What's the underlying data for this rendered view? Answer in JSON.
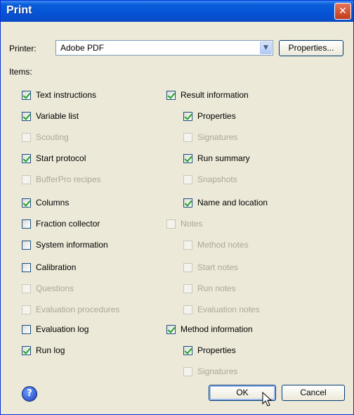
{
  "window": {
    "title": "Print",
    "close_glyph": "✕"
  },
  "printer": {
    "label": "Printer:",
    "selected": "Adobe PDF",
    "properties_button": "Properties..."
  },
  "items_label": "Items:",
  "left_items": [
    {
      "label": "Text instructions",
      "checked": true,
      "enabled": true
    },
    {
      "label": "Variable list",
      "checked": true,
      "enabled": true
    },
    {
      "label": "Scouting",
      "checked": false,
      "enabled": false
    },
    {
      "label": "Start protocol",
      "checked": true,
      "enabled": true
    },
    {
      "label": "BufferPro recipes",
      "checked": false,
      "enabled": false
    },
    {
      "label": "Columns",
      "checked": true,
      "enabled": true
    },
    {
      "label": "Fraction collector",
      "checked": false,
      "enabled": true
    },
    {
      "label": "System information",
      "checked": false,
      "enabled": true
    },
    {
      "label": "Calibration",
      "checked": false,
      "enabled": true
    },
    {
      "label": "Questions",
      "checked": false,
      "enabled": false
    },
    {
      "label": "Evaluation procedures",
      "checked": false,
      "enabled": false
    },
    {
      "label": "Evaluation log",
      "checked": false,
      "enabled": true
    },
    {
      "label": "Run log",
      "checked": true,
      "enabled": true
    }
  ],
  "right_items": [
    {
      "label": "Result information",
      "checked": true,
      "enabled": true,
      "indent": 0
    },
    {
      "label": "Properties",
      "checked": true,
      "enabled": true,
      "indent": 1
    },
    {
      "label": "Signatures",
      "checked": false,
      "enabled": false,
      "indent": 1
    },
    {
      "label": "Run summary",
      "checked": true,
      "enabled": true,
      "indent": 1
    },
    {
      "label": "Snapshots",
      "checked": false,
      "enabled": false,
      "indent": 1
    },
    {
      "label": "Name and location",
      "checked": true,
      "enabled": true,
      "indent": 1
    },
    {
      "label": "Notes",
      "checked": false,
      "enabled": false,
      "indent": 0
    },
    {
      "label": "Method notes",
      "checked": false,
      "enabled": false,
      "indent": 1
    },
    {
      "label": "Start notes",
      "checked": false,
      "enabled": false,
      "indent": 1
    },
    {
      "label": "Run notes",
      "checked": false,
      "enabled": false,
      "indent": 1
    },
    {
      "label": "Evaluation notes",
      "checked": false,
      "enabled": false,
      "indent": 1
    },
    {
      "label": "Method information",
      "checked": true,
      "enabled": true,
      "indent": 0
    },
    {
      "label": "Properties",
      "checked": true,
      "enabled": true,
      "indent": 1
    },
    {
      "label": "Signatures",
      "checked": false,
      "enabled": false,
      "indent": 1
    }
  ],
  "buttons": {
    "ok": "OK",
    "cancel": "Cancel",
    "help_glyph": "?"
  },
  "icons": {
    "help": "help-icon",
    "close": "close-icon",
    "dropdown": "chevron-down-icon",
    "cursor": "arrow-cursor-icon"
  }
}
